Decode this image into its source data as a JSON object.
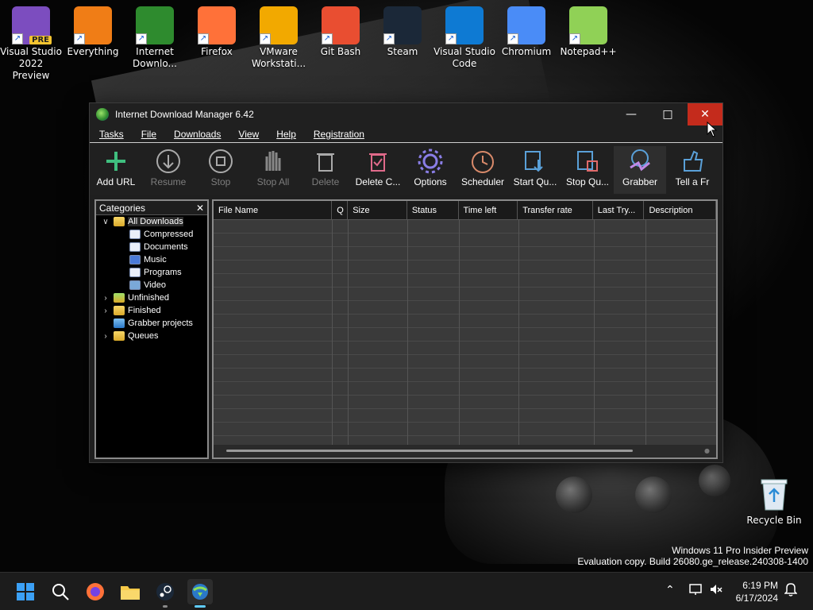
{
  "desktop": {
    "icons": [
      {
        "label": "Visual Studio 2022 Preview",
        "icon": "visual-studio-preview-icon",
        "badge": "PRE",
        "color": "#7c4dbf"
      },
      {
        "label": "Everything",
        "icon": "everything-search-icon",
        "color": "#f07d16"
      },
      {
        "label": "Internet Downlo...",
        "icon": "internet-download-manager-icon",
        "color": "#2e8b2e"
      },
      {
        "label": "Firefox",
        "icon": "firefox-icon",
        "color": "#ff7139"
      },
      {
        "label": "VMware Workstati...",
        "icon": "vmware-icon",
        "color": "#f2a900"
      },
      {
        "label": "Git Bash",
        "icon": "git-bash-icon",
        "color": "#e94e31"
      },
      {
        "label": "Steam",
        "icon": "steam-icon",
        "color": "#1b2838"
      },
      {
        "label": "Visual Studio Code",
        "icon": "vscode-icon",
        "color": "#0e7ad3"
      },
      {
        "label": "Chromium",
        "icon": "chromium-icon",
        "color": "#4a8cf7"
      },
      {
        "label": "Notepad++",
        "icon": "notepad-plus-plus-icon",
        "color": "#90d156"
      }
    ],
    "recycle_bin": {
      "label": "Recycle Bin",
      "icon": "recycle-bin-icon"
    },
    "watermark": {
      "line1": "Windows 11 Pro Insider Preview",
      "line2": "Evaluation copy. Build 26080.ge_release.240308-1400"
    }
  },
  "window": {
    "title": "Internet Download Manager 6.42",
    "menu": [
      "Tasks",
      "File",
      "Downloads",
      "View",
      "Help",
      "Registration"
    ],
    "toolbar": [
      {
        "label": "Add URL",
        "icon": "add-url-icon",
        "enabled": true
      },
      {
        "label": "Resume",
        "icon": "resume-icon",
        "enabled": false
      },
      {
        "label": "Stop",
        "icon": "stop-icon",
        "enabled": false
      },
      {
        "label": "Stop All",
        "icon": "stop-all-icon",
        "enabled": false
      },
      {
        "label": "Delete",
        "icon": "delete-icon",
        "enabled": false
      },
      {
        "label": "Delete C...",
        "icon": "delete-completed-icon",
        "enabled": true
      },
      {
        "label": "Options",
        "icon": "options-icon",
        "enabled": true
      },
      {
        "label": "Scheduler",
        "icon": "scheduler-icon",
        "enabled": true
      },
      {
        "label": "Start Qu...",
        "icon": "start-queue-icon",
        "enabled": true
      },
      {
        "label": "Stop Qu...",
        "icon": "stop-queue-icon",
        "enabled": true
      },
      {
        "label": "Grabber",
        "icon": "grabber-icon",
        "enabled": true
      },
      {
        "label": "Tell a Fr",
        "icon": "tell-a-friend-icon",
        "enabled": true
      }
    ],
    "categories": {
      "title": "Categories",
      "tree": [
        {
          "label": "All Downloads",
          "level": 0,
          "expander": "v",
          "icon": "folder",
          "selected": true
        },
        {
          "label": "Compressed",
          "level": 1,
          "expander": "",
          "icon": "file"
        },
        {
          "label": "Documents",
          "level": 1,
          "expander": "",
          "icon": "file"
        },
        {
          "label": "Music",
          "level": 1,
          "expander": "",
          "icon": "music"
        },
        {
          "label": "Programs",
          "level": 1,
          "expander": "",
          "icon": "program"
        },
        {
          "label": "Video",
          "level": 1,
          "expander": "",
          "icon": "video"
        },
        {
          "label": "Unfinished",
          "level": 0,
          "expander": ">",
          "icon": "folder-green"
        },
        {
          "label": "Finished",
          "level": 0,
          "expander": ">",
          "icon": "folder-check"
        },
        {
          "label": "Grabber projects",
          "level": 0,
          "expander": "",
          "icon": "folder-blue"
        },
        {
          "label": "Queues",
          "level": 0,
          "expander": ">",
          "icon": "folder"
        }
      ]
    },
    "columns": [
      {
        "label": "File Name"
      },
      {
        "label": "Q"
      },
      {
        "label": "Size"
      },
      {
        "label": "Status"
      },
      {
        "label": "Time left"
      },
      {
        "label": "Transfer rate"
      },
      {
        "label": "Last Try..."
      },
      {
        "label": "Description"
      }
    ]
  },
  "taskbar": {
    "clock_time": "6:19 PM",
    "clock_date": "6/17/2024",
    "pinned": [
      "start-icon",
      "search-icon",
      "firefox-icon",
      "file-explorer-icon",
      "steam-icon",
      "internet-download-manager-icon"
    ]
  }
}
